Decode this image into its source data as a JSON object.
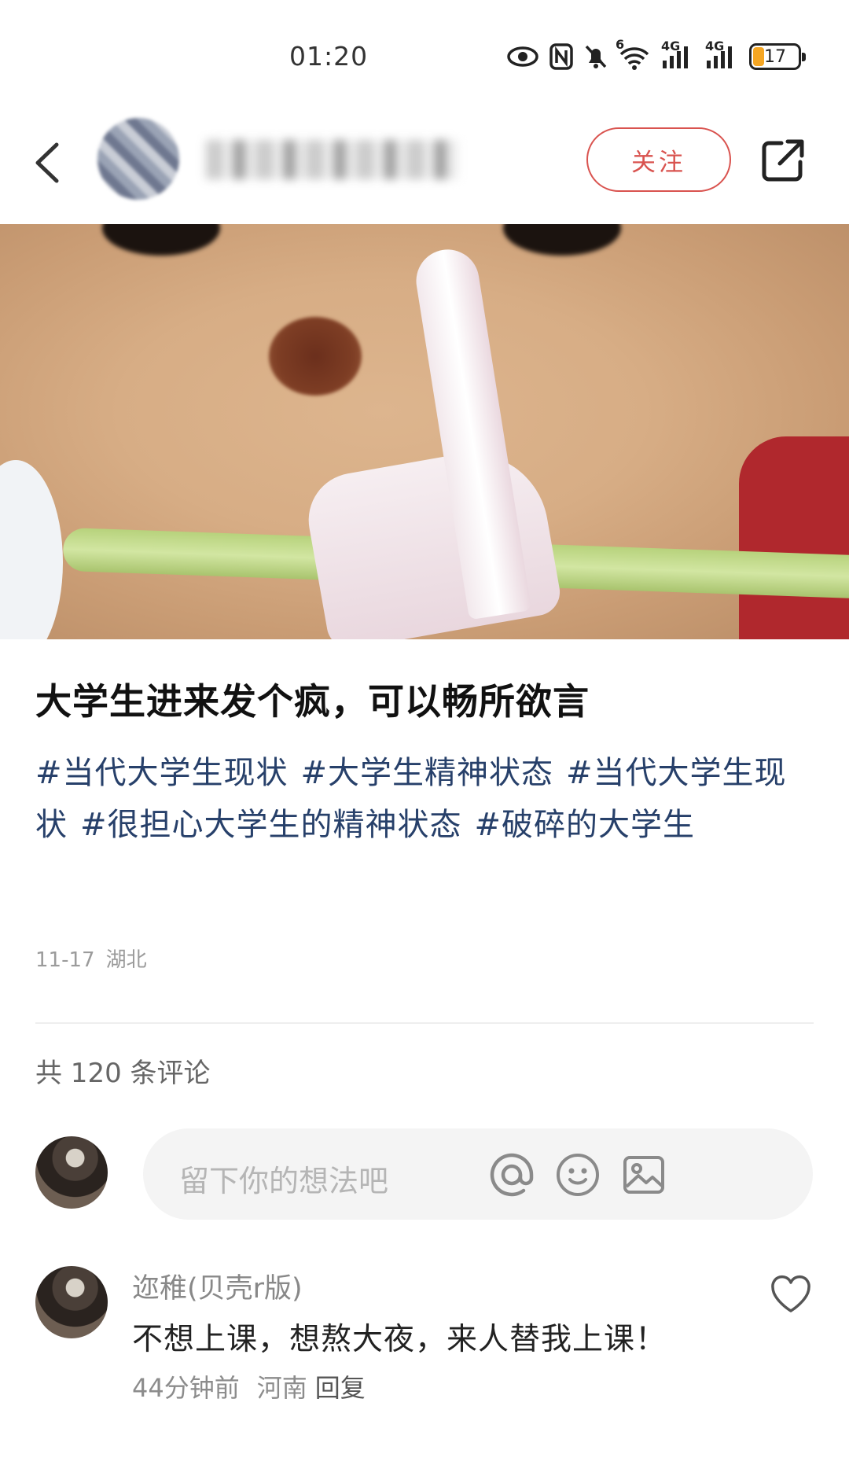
{
  "status_bar": {
    "time": "01:20",
    "icons": [
      "eye-icon",
      "nfc-icon",
      "mute-icon",
      "wifi-icon",
      "signal-4g-1-icon",
      "signal-4g-2-icon"
    ],
    "wifi_badge": "6",
    "net1": "4G",
    "net2": "4G",
    "battery": "17",
    "battery_color": "#f5a623"
  },
  "header": {
    "follow_label": "关注",
    "accent": "#d9534f"
  },
  "post": {
    "title": "大学生进来发个疯，可以畅所欲言",
    "tags": [
      "#当代大学生现状",
      "#大学生精神状态",
      "#当代大学生现状",
      "#很担心大学生的精神状态",
      "#破碎的大学生"
    ],
    "date": "11-17",
    "location": "湖北",
    "tag_color": "#27406a"
  },
  "comments_header": {
    "count_text": "共 120 条评论"
  },
  "comment_input": {
    "placeholder": "留下你的想法吧"
  },
  "comments": [
    {
      "user": "迩稚(贝壳r版)",
      "text": "不想上课，想熬大夜，来人替我上课！",
      "time": "44分钟前",
      "location": "河南",
      "reply_label": "回复"
    }
  ]
}
